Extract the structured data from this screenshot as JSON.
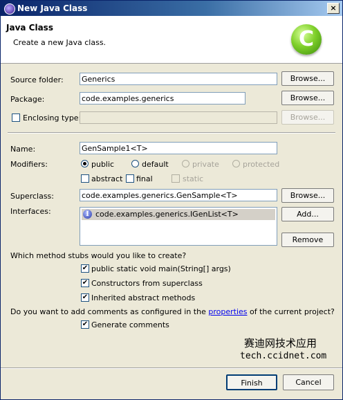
{
  "window": {
    "title": "New Java Class",
    "close_glyph": "×"
  },
  "banner": {
    "heading": "Java Class",
    "description": "Create a new Java class.",
    "logo_letter": "C"
  },
  "form": {
    "source_folder": {
      "label": "Source folder:",
      "value": "Generics",
      "button": "Browse..."
    },
    "package": {
      "label": "Package:",
      "value": "code.examples.generics",
      "button": "Browse..."
    },
    "enclosing_type": {
      "label": "Enclosing type:",
      "value": "",
      "button": "Browse..."
    },
    "name": {
      "label": "Name:",
      "value": "GenSample1<T>"
    },
    "modifiers": {
      "label": "Modifiers:",
      "public": "public",
      "default": "default",
      "private": "private",
      "protected": "protected",
      "abstract": "abstract",
      "final": "final",
      "static": "static"
    },
    "superclass": {
      "label": "Superclass:",
      "value": "code.examples.generics.GenSample<T>",
      "button": "Browse..."
    },
    "interfaces": {
      "label": "Interfaces:",
      "items": [
        "code.examples.generics.IGenList<T>"
      ],
      "add_button": "Add...",
      "remove_button": "Remove"
    }
  },
  "stubs": {
    "question": "Which method stubs would you like to create?",
    "main": "public static void main(String[] args)",
    "constructors": "Constructors from superclass",
    "inherited": "Inherited abstract methods"
  },
  "comments": {
    "question_prefix": "Do you want to add comments as configured in the ",
    "link": "properties",
    "question_suffix": " of the current project?",
    "generate": "Generate comments"
  },
  "watermark": {
    "cn": "赛迪网技术应用",
    "url": "tech.ccidnet.com"
  },
  "footer": {
    "finish": "Finish",
    "cancel": "Cancel"
  },
  "colors": {
    "title_bar": "#0a246a",
    "link": "#0000ee",
    "logo": "#7fd02a"
  }
}
